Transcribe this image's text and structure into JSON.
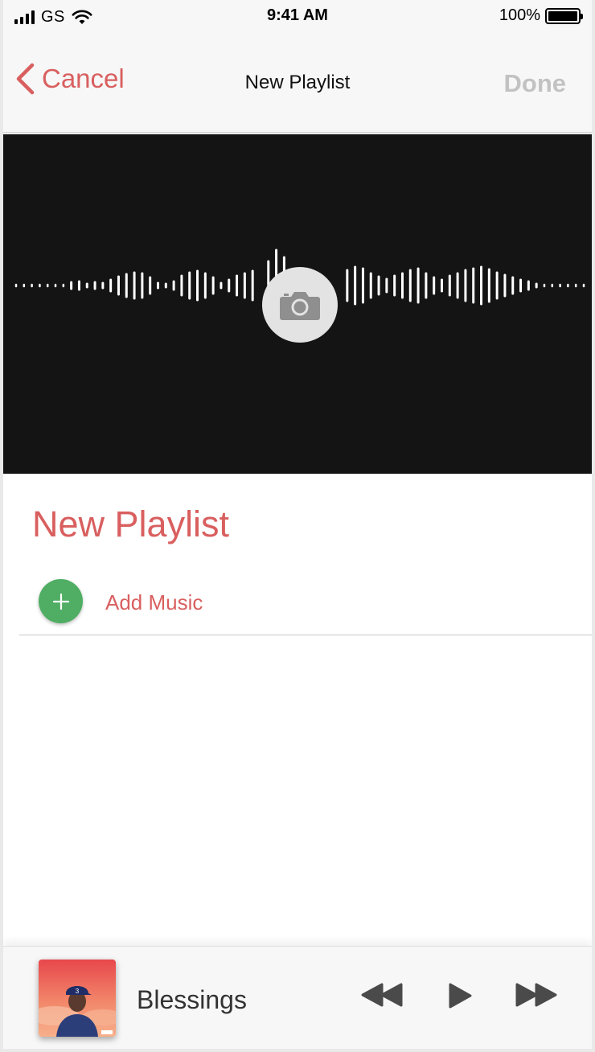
{
  "status_bar": {
    "carrier": "GS",
    "time": "9:41 AM",
    "battery": "100%"
  },
  "nav": {
    "cancel_label": "Cancel",
    "title": "New Playlist",
    "done_label": "Done"
  },
  "playlist": {
    "name": "New Playlist",
    "add_music_label": "Add Music"
  },
  "now_playing": {
    "title": "Blessings"
  },
  "colors": {
    "accent": "#d95f5f",
    "add_button": "#4fae63",
    "done_disabled": "#c2c2c2",
    "artwork_bg": "#141414"
  },
  "icons": {
    "back": "chevron-left-icon",
    "camera": "camera-icon",
    "add": "plus-icon",
    "rewind": "rewind-icon",
    "play": "play-icon",
    "fast_forward": "fast-forward-icon"
  }
}
